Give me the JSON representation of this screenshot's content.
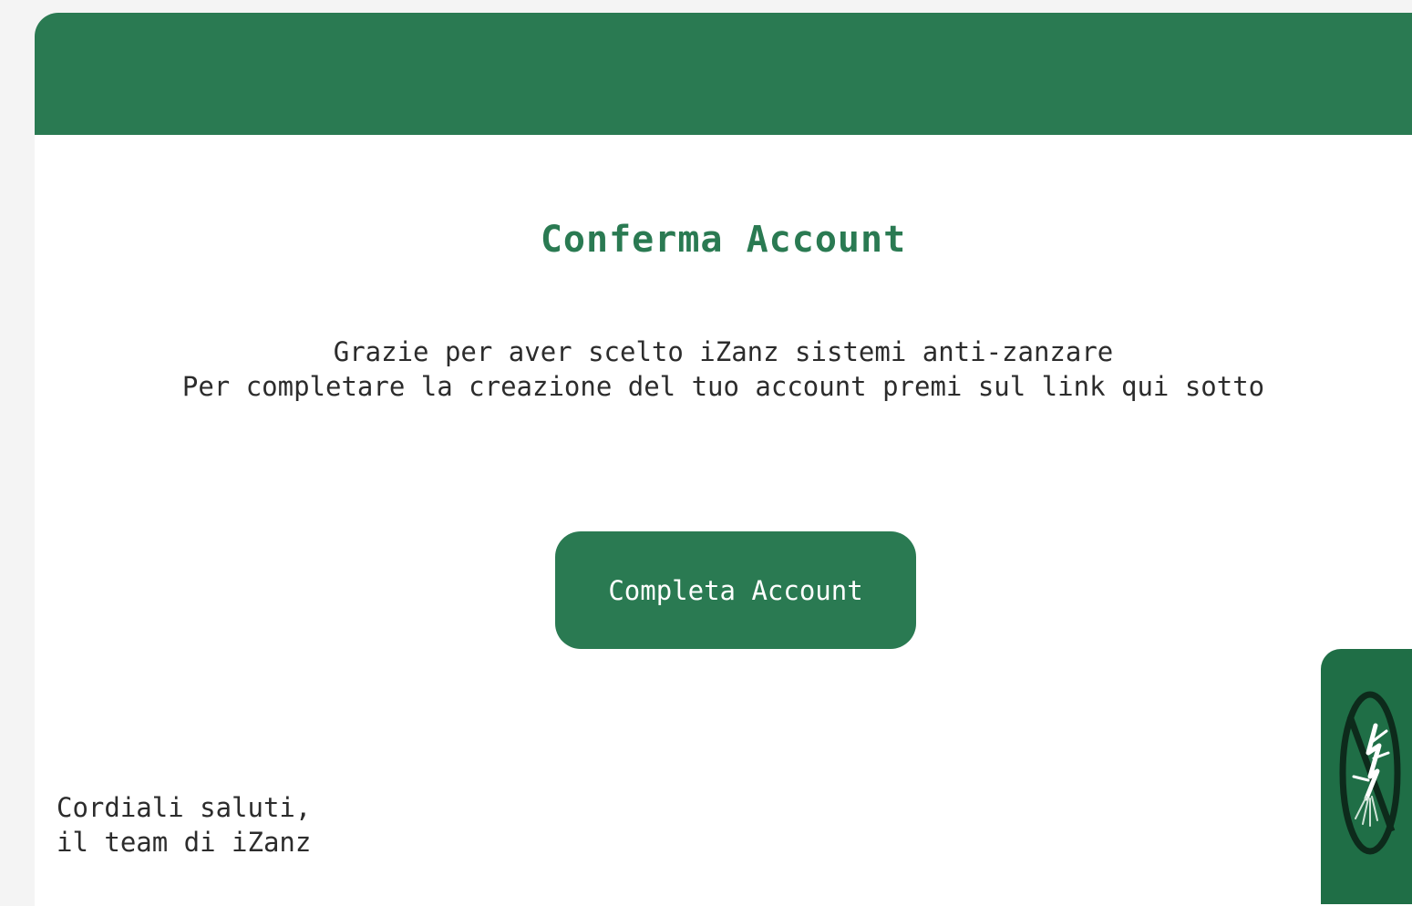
{
  "email": {
    "title": "Conferma Account",
    "message_lines": [
      "Grazie per aver scelto iZanz sistemi anti-zanzare",
      "Per completare la creazione del tuo account premi sul link qui sotto"
    ],
    "cta_label": "Completa Account",
    "signoff_lines": [
      "Cordiali saluti,",
      "il team di iZanz"
    ]
  },
  "logo": {
    "icon": "no-mosquito-icon"
  },
  "colors": {
    "brand_green": "#2a7a52",
    "text": "#2c2c2c",
    "background": "#f4f4f4"
  }
}
